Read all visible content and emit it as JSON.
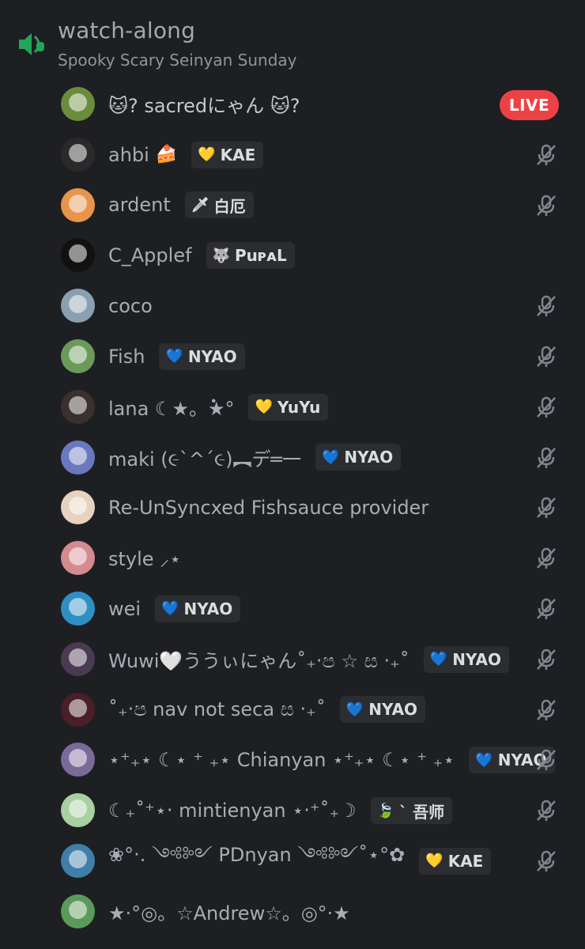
{
  "channel": {
    "name": "watch-along",
    "topic": "Spooky Scary Seinyan Sunday"
  },
  "colors": {
    "background": "#1e1f22",
    "speaker_icon": "#23a55a",
    "live": "#ed4245",
    "tag_bg": "#2b2d31"
  },
  "members": [
    {
      "name": "🐱? sacredにゃん 🐱?",
      "tag_icon": "",
      "tag": "",
      "status": "live",
      "live_label": "LIVE",
      "avatar": "#6b8c3a"
    },
    {
      "name": "ahbi",
      "emoji": "🍰",
      "tag_icon": "💛",
      "tag": "KAE",
      "status": "muted",
      "avatar": "#2a2a2a"
    },
    {
      "name": "ardent",
      "tag_icon": "🗡",
      "tag": "白厄",
      "status": "muted",
      "avatar": "#e8944a"
    },
    {
      "name": "C_Applef",
      "tag_icon": "🐺",
      "tag": "PuᴘᴀL",
      "status": "none",
      "avatar": "#111111"
    },
    {
      "name": "coco",
      "tag_icon": "",
      "tag": "",
      "status": "muted",
      "avatar": "#8aa0b0"
    },
    {
      "name": "Fish",
      "tag_icon": "💙",
      "tag": "NYAO",
      "status": "muted",
      "avatar": "#6a9a5a"
    },
    {
      "name": "lana ☾★。̇★°",
      "tag_icon": "💛",
      "tag": "YuYu",
      "status": "muted",
      "avatar": "#3a3030"
    },
    {
      "name": "maki (૯`^´૯)︻デ═一",
      "tag_icon": "💙",
      "tag": "NYAO",
      "status": "muted",
      "avatar": "#6a78c0"
    },
    {
      "name": "Re-UnSyncxed Fishsauce provider",
      "tag_icon": "",
      "tag": "",
      "status": "muted",
      "avatar": "#e6d2bf"
    },
    {
      "name": "style ⸝⋆",
      "tag_icon": "",
      "tag": "",
      "status": "muted",
      "avatar": "#d58a90"
    },
    {
      "name": "wei",
      "tag_icon": "💙",
      "tag": "NYAO",
      "status": "muted",
      "avatar": "#2f8fc4"
    },
    {
      "name": "Wuwi🤍ううぃにゃん˚₊‧ප ☆ ස ‧₊˚",
      "tag_icon": "💙",
      "tag": "NYAO",
      "status": "muted",
      "avatar": "#4a3a52"
    },
    {
      "name": "˚₊‧ප nav not seca ස ‧₊˚",
      "tag_icon": "💙",
      "tag": "NYAO",
      "status": "muted",
      "avatar": "#4a1f2a"
    },
    {
      "name": "⋆⁺₊⋆ ☾⋆ ⁺ ₊⋆ Chianyan ⋆⁺₊⋆ ☾⋆ ⁺ ₊⋆",
      "tag_icon": "💙",
      "tag": "NYAO",
      "status": "muted",
      "avatar": "#7a6a9a"
    },
    {
      "name": "☾₊˚⁺⋆‧ mintienyan ⋆‧⁺˚₊☽",
      "tag_icon": "🍃",
      "tag": "` 吾师",
      "status": "muted",
      "avatar": "#a8d0a0"
    },
    {
      "name": "❀°‧. ༺༻ PDnyan ༺༻˚⋆°✿",
      "tag_icon": "💛",
      "tag": "KAE",
      "status": "muted",
      "avatar": "#3f7fa8"
    },
    {
      "name": "★·°◎。☆Andrew☆。◎°·★",
      "tag_icon": "",
      "tag": "",
      "status": "none",
      "avatar": "#5a9a5a"
    }
  ]
}
